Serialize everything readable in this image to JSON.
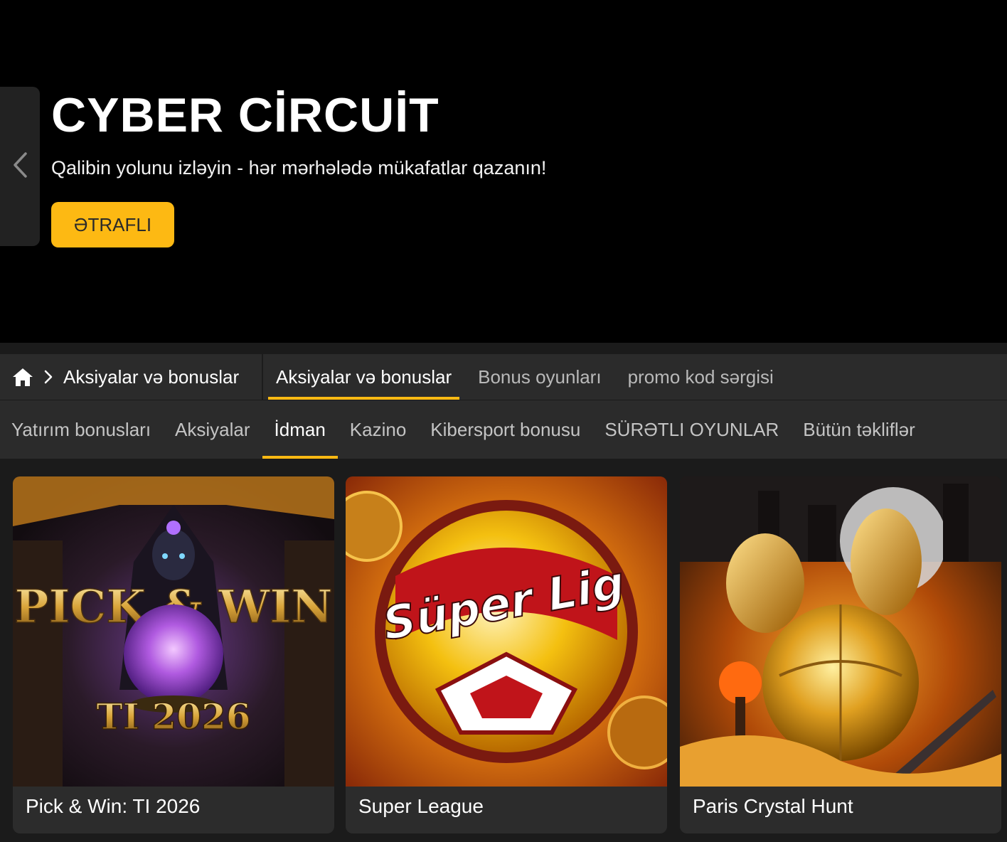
{
  "hero": {
    "title": "CYBER CİRCUİT",
    "subtitle": "Qalibin yolunu izləyin - hər mərhələdə mükafatlar qazanın!",
    "button_label": "ƏTRAFLI",
    "accent_color": "#fdb913"
  },
  "breadcrumb": {
    "home_icon": "home-icon",
    "current": "Aksiyalar və bonuslar"
  },
  "nav_tabs": [
    {
      "label": "Aksiyalar və bonuslar",
      "active": true
    },
    {
      "label": "Bonus oyunları",
      "active": false
    },
    {
      "label": "promo kod sərgisi",
      "active": false
    }
  ],
  "categories": [
    {
      "label": "Yatırım bonusları",
      "active": false
    },
    {
      "label": "Aksiyalar",
      "active": false
    },
    {
      "label": "İdman",
      "active": true
    },
    {
      "label": "Kazino",
      "active": false
    },
    {
      "label": "Kibersport bonusu",
      "active": false
    },
    {
      "label": "SÜRƏTLI OYUNLAR",
      "active": false
    },
    {
      "label": "Bütün təkliflər",
      "active": false
    }
  ],
  "cards": [
    {
      "title": "Pick & Win: TI 2026",
      "art_text": "PICK & WIN",
      "art_badge": "TI 2026"
    },
    {
      "title": "Super League",
      "art_text": "Süper Lig"
    },
    {
      "title": "Paris Crystal Hunt"
    }
  ]
}
